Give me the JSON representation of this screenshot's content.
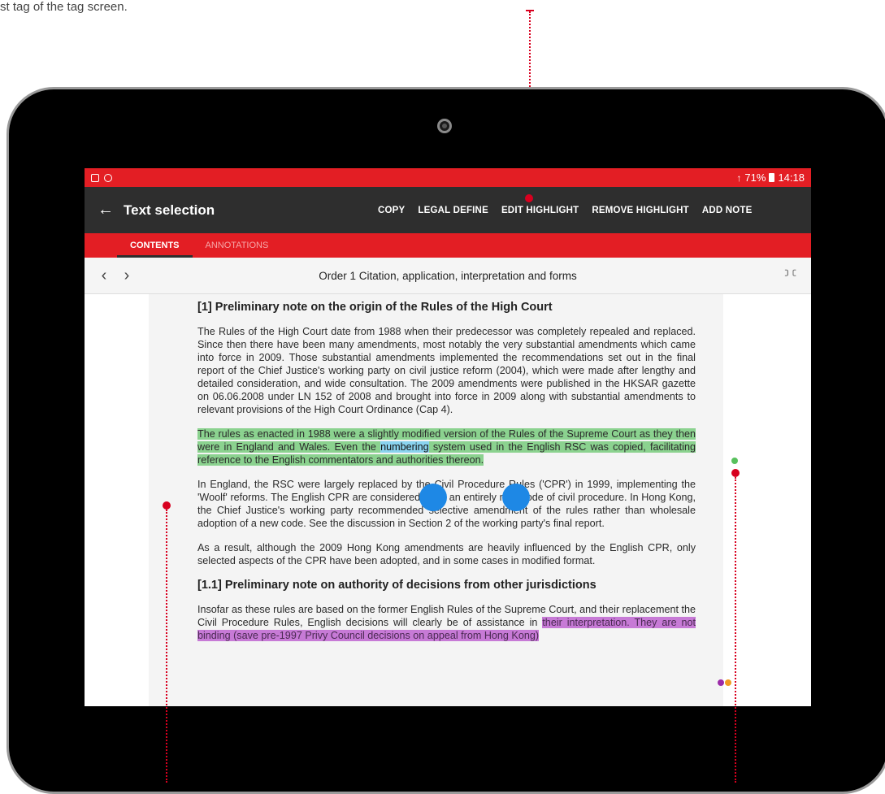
{
  "caption": "st tag of the tag screen.",
  "status_bar": {
    "battery": "71%",
    "time": "14:18",
    "wifi_icon": "wifi-icon",
    "battery_icon": "battery-icon"
  },
  "action_bar": {
    "title": "Text selection",
    "actions": [
      "COPY",
      "LEGAL DEFINE",
      "EDIT HIGHLIGHT",
      "REMOVE HIGHLIGHT",
      "ADD NOTE"
    ]
  },
  "tabs": [
    {
      "label": "CONTENTS",
      "active": true
    },
    {
      "label": "ANNOTATIONS",
      "active": false
    }
  ],
  "navigation": {
    "title": "Order 1 Citation, application, interpretation and forms"
  },
  "document": {
    "heading1": "[1] Preliminary note on the origin of the Rules of the High Court",
    "para1": "The Rules of the High Court date from 1988 when their predecessor was completely repealed and replaced. Since then there have been many amendments, most notably the very substantial amendments which came into force in 2009. Those substantial amendments implemented the recommendations set out in the final report of the Chief Justice's working party on civil justice reform (2004), which were made after lengthy and detailed consideration, and wide consultation. The 2009 amendments were published in the HKSAR gazette on 06.06.2008 under LN 152 of 2008 and brought into force in 2009 along with substantial amendments to relevant provisions of the High Court Ordinance (Cap 4).",
    "para2_before": "The rules as enacted in 1988 were a slightly modified version of the Rules of the Supreme Court as they then were in England and Wales. Even the ",
    "para2_selected": "numbering",
    "para2_after": " system used in the English RSC was copied, facilitating reference to the English commentators and authorities thereon.",
    "para3": "In England, the RSC were largely replaced by the Civil Procedure Rules ('CPR') in 1999, implementing the 'Woolf' reforms. The English CPR are considered to be an entirely new code of civil procedure. In Hong Kong, the Chief Justice's working party recommended selective amendment of the rules rather than wholesale adoption of a new code. See the discussion in Section 2 of the working party's final report.",
    "para4": "As a result, although the 2009 Hong Kong amendments are heavily influenced by the English CPR, only selected aspects of the CPR have been adopted, and in some cases in modified format.",
    "heading2": "[1.1] Preliminary note on authority of decisions from other jurisdictions",
    "para5_before": "Insofar as these rules are based on the former English Rules of the Supreme Court, and their replacement the Civil Procedure Rules, English decisions will clearly be of assistance in ",
    "para5_highlight": "their interpretation. They are not binding (save pre-1997 Privy Council decisions on appeal from Hong Kong)"
  },
  "colors": {
    "brand_red": "#e31e24",
    "actionbar": "#2e2e2e",
    "highlight_green": "#8bd28f",
    "selection_blue": "#8ad3ef",
    "highlight_purple": "#c77ad6",
    "handle_blue": "#1e88e5",
    "callout_red": "#d8001f"
  }
}
